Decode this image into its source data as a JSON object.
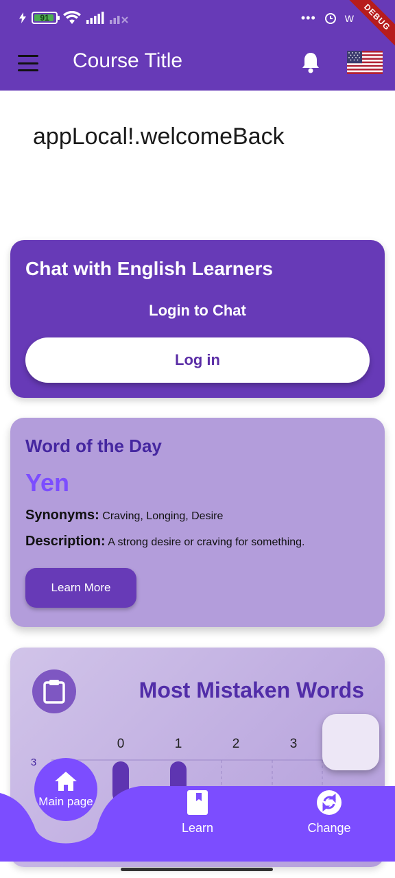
{
  "status_bar": {
    "battery": "91",
    "right_text": "W"
  },
  "debug_label": "DEBUG",
  "app_bar": {
    "title": "Course Title",
    "menu_icon": "hamburger-menu-icon",
    "bell_icon": "bell-icon",
    "flag_icon": "us-flag-icon"
  },
  "welcome_text": "appLocal!.welcomeBack",
  "chat_card": {
    "title": "Chat with English Learners",
    "subtitle": "Login to Chat",
    "login_label": "Log in"
  },
  "word_of_day": {
    "heading": "Word of the Day",
    "word": "Yen",
    "synonyms_label": "Synonyms:",
    "synonyms_value": "Craving, Longing, Desire",
    "description_label": "Description:",
    "description_value": "A strong desire or craving for something.",
    "button_label": "Learn More"
  },
  "mistaken_words": {
    "title": "Most Mistaken Words",
    "icon": "clipboard-icon"
  },
  "chart_data": {
    "type": "bar",
    "categories": [
      "0",
      "1",
      "2",
      "3"
    ],
    "y_tick_visible": "3",
    "values": [
      null,
      null,
      null,
      null
    ],
    "note_visible": "partially cut off by bottom navigation"
  },
  "bottom_nav": {
    "items": [
      {
        "label": "Main page",
        "icon": "home-icon"
      },
      {
        "label": "Learn",
        "icon": "book-icon"
      },
      {
        "label": "Change",
        "icon": "sync-icon"
      }
    ]
  },
  "colors": {
    "primary": "#673ab7",
    "accent": "#7c4dff",
    "card_light": "#b39ddb"
  }
}
